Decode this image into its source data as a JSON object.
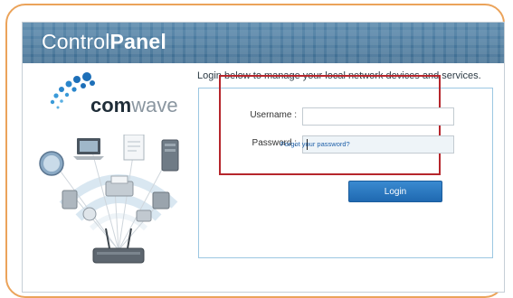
{
  "header": {
    "title_light": "Control",
    "title_bold": "Panel"
  },
  "brand": {
    "name_bold": "com",
    "name_light": "wave"
  },
  "intro_text": "Login below to manage your local network devices and services.",
  "form": {
    "username_label": "Username :",
    "username_value": "",
    "password_label": "Password :",
    "password_value": "",
    "forgot_link": "Forgot your password?",
    "login_button": "Login"
  },
  "colors": {
    "header": "#3f6e93",
    "frame": "#eba35a",
    "highlight": "#b6262c",
    "button": "#2a7cc3",
    "link": "#1d5fa8"
  },
  "icons": [
    "comwave-logo-dots",
    "network-devices-illustration"
  ]
}
